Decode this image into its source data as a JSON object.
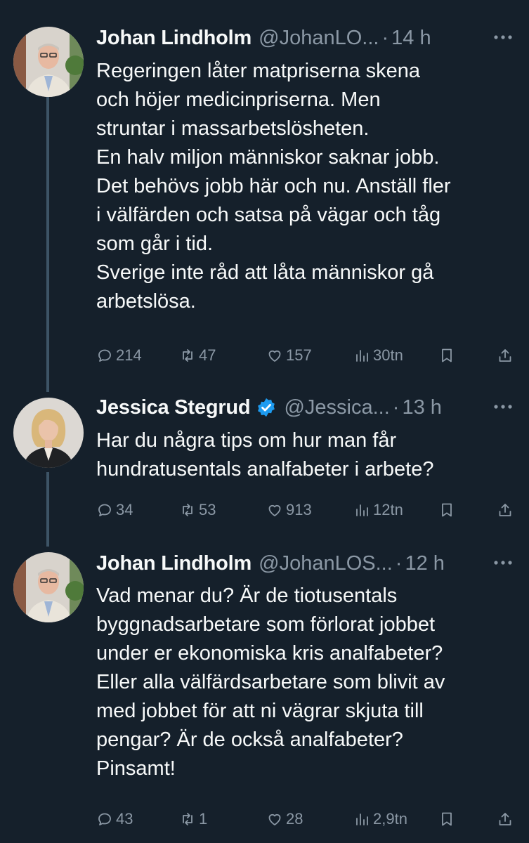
{
  "tweets": [
    {
      "name": "Johan Lindholm",
      "handle": "@JohanLO...",
      "dot": "·",
      "time": "14 h",
      "verified": false,
      "lines": [
        "Regeringen låter matpriserna skena",
        "och höjer medicinpriserna. Men",
        "struntar i massarbetslösheten.",
        "En halv miljon människor saknar jobb.",
        "Det behövs jobb här och nu. Anställ fler",
        "i välfärden och satsa på vägar och tåg",
        "som går i tid.",
        "Sverige inte råd att låta människor gå",
        "arbetslösa."
      ],
      "replies": "214",
      "retweets": "47",
      "likes": "157",
      "views": "30tn"
    },
    {
      "name": "Jessica Stegrud",
      "handle": "@Jessica...",
      "dot": "·",
      "time": "13 h",
      "verified": true,
      "lines": [
        "Har du några tips om hur man får",
        "hundratusentals analfabeter i arbete?"
      ],
      "replies": "34",
      "retweets": "53",
      "likes": "913",
      "views": "12tn"
    },
    {
      "name": "Johan Lindholm",
      "handle": "@JohanLOS...",
      "dot": "·",
      "time": "12 h",
      "verified": false,
      "lines": [
        "Vad menar du? Är de tiotusentals",
        "byggnadsarbetare som förlorat jobbet",
        "under er ekonomiska kris analfabeter?",
        "Eller alla välfärdsarbetare som blivit av",
        "med jobbet för att ni vägrar skjuta till",
        "pengar? Är de också analfabeter?",
        "Pinsamt!"
      ],
      "replies": "43",
      "retweets": "1",
      "likes": "28",
      "views": "2,9tn"
    }
  ],
  "colors": {
    "background": "#15202b",
    "text": "#f7f9f9",
    "muted": "#8b98a5",
    "thread_line": "#3d5466",
    "verified": "#1d9bf0"
  },
  "icons": {
    "reply": "reply-icon",
    "retweet": "retweet-icon",
    "like": "heart-icon",
    "views": "views-icon",
    "bookmark": "bookmark-icon",
    "share": "share-icon",
    "more": "more-icon",
    "verified": "verified-badge-icon"
  }
}
